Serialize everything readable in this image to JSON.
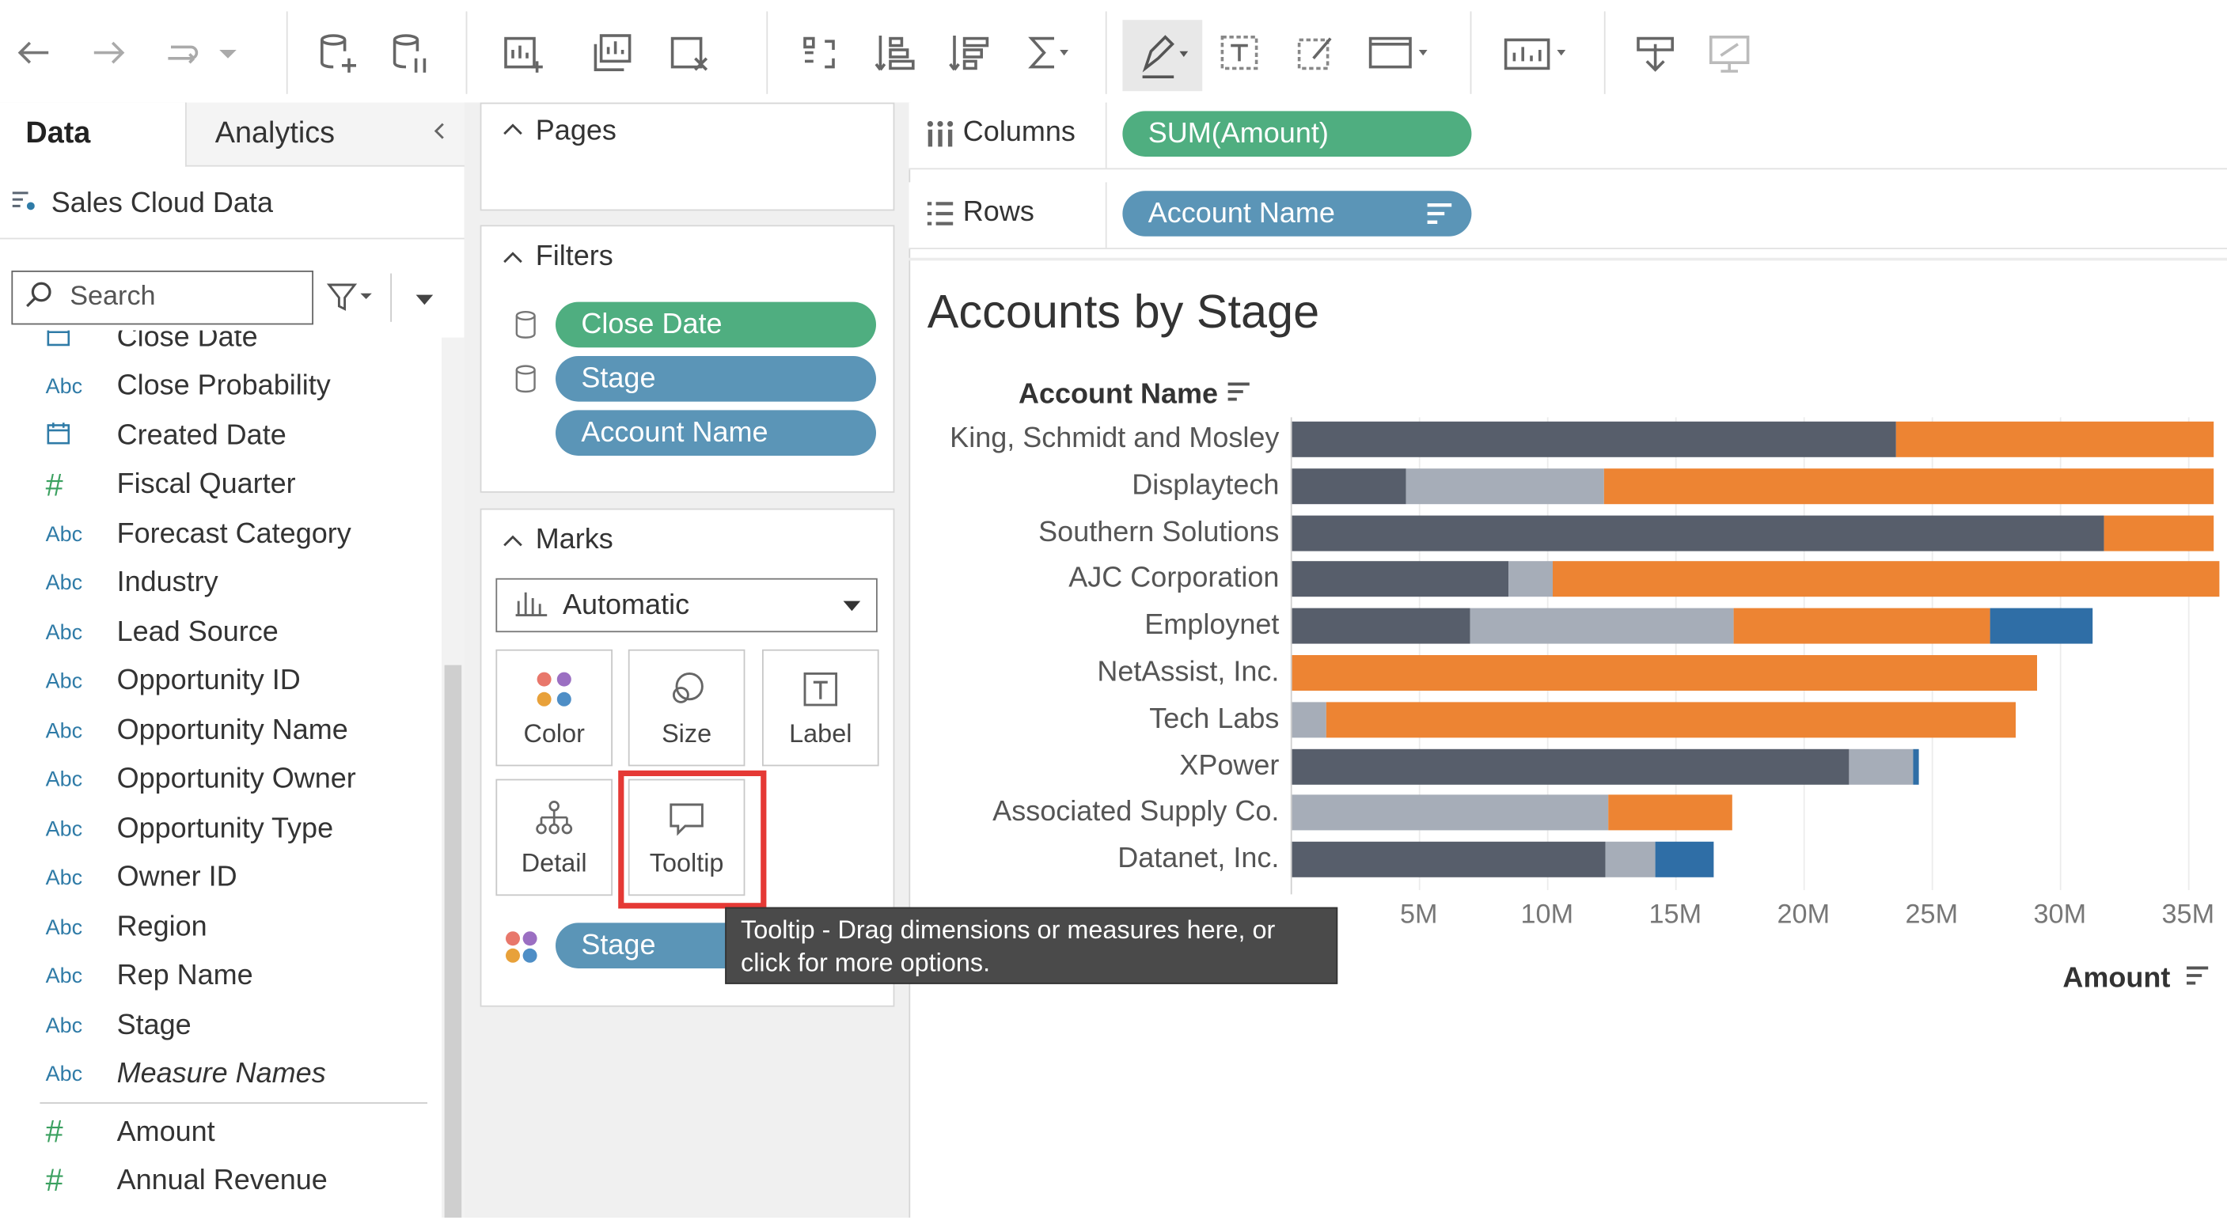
{
  "left_pane": {
    "tabs": [
      "Data",
      "Analytics"
    ],
    "datasource": "Sales Cloud Data",
    "search_placeholder": "Search",
    "fields": [
      {
        "icon": "date",
        "name": "Close Date"
      },
      {
        "icon": "abc",
        "name": "Close Probability"
      },
      {
        "icon": "date",
        "name": "Created Date"
      },
      {
        "icon": "hash",
        "name": "Fiscal Quarter"
      },
      {
        "icon": "abc",
        "name": "Forecast Category"
      },
      {
        "icon": "abc",
        "name": "Industry"
      },
      {
        "icon": "abc",
        "name": "Lead Source"
      },
      {
        "icon": "abc",
        "name": "Opportunity ID"
      },
      {
        "icon": "abc",
        "name": "Opportunity Name"
      },
      {
        "icon": "abc",
        "name": "Opportunity Owner"
      },
      {
        "icon": "abc",
        "name": "Opportunity Type"
      },
      {
        "icon": "abc",
        "name": "Owner ID"
      },
      {
        "icon": "abc",
        "name": "Region"
      },
      {
        "icon": "abc",
        "name": "Rep Name"
      },
      {
        "icon": "abc",
        "name": "Stage"
      },
      {
        "icon": "abc",
        "name": "Measure Names"
      }
    ],
    "measures": [
      {
        "icon": "hash",
        "name": "Amount"
      },
      {
        "icon": "hash",
        "name": "Annual Revenue"
      }
    ],
    "abc_text": "Abc",
    "hash_text": "#"
  },
  "cards": {
    "pages_title": "Pages",
    "filters_title": "Filters",
    "filters": [
      "Close Date",
      "Stage",
      "Account Name"
    ],
    "marks_title": "Marks",
    "mark_type": "Automatic",
    "mark_buttons": [
      "Color",
      "Size",
      "Label",
      "Detail",
      "Tooltip"
    ],
    "color_pill": "Stage"
  },
  "shelves": {
    "columns_label": "Columns",
    "columns_pill": "SUM(Amount)",
    "rows_label": "Rows",
    "rows_pill": "Account Name"
  },
  "tooltip": {
    "text": "Tooltip - Drag dimensions or measures here, or click for more options."
  },
  "colors": {
    "dark": "#575e6b",
    "light": "#a6adb8",
    "orange": "#ed8433",
    "blue": "#2f6ea6",
    "green_pill": "#4fae80",
    "blue_pill": "#5b95b7",
    "highlight": "#e53935"
  },
  "chart_data": {
    "type": "bar",
    "title": "Accounts by Stage",
    "row_header": "Account Name",
    "xlabel": "Amount",
    "xlim": [
      0,
      36
    ],
    "x_ticks": [
      "5M",
      "10M",
      "15M",
      "20M",
      "25M",
      "30M",
      "35M"
    ],
    "x_tick_values": [
      5,
      10,
      15,
      20,
      25,
      30,
      35
    ],
    "unit": "M",
    "categories": [
      "King, Schmidt and Mosley",
      "Displaytech",
      "Southern Solutions",
      "AJC Corporation",
      "Employnet",
      "NetAssist, Inc.",
      "Tech Labs",
      "XPower",
      "Associated Supply Co.",
      "Datanet, Inc."
    ],
    "series": [
      {
        "color": "#575e6b",
        "values": [
          23.6,
          4.5,
          31.7,
          8.5,
          7.0,
          0,
          0,
          21.8,
          0,
          12.3
        ]
      },
      {
        "color": "#a6adb8",
        "values": [
          0,
          7.7,
          0,
          1.7,
          10.3,
          0,
          1.4,
          2.5,
          12.4,
          1.9
        ]
      },
      {
        "color": "#ed8433",
        "values": [
          12.4,
          23.8,
          4.3,
          26.0,
          10.0,
          29.1,
          26.9,
          0,
          4.8,
          0
        ]
      },
      {
        "color": "#2f6ea6",
        "values": [
          0,
          0,
          0,
          0,
          4.0,
          0,
          0,
          0.2,
          0,
          2.3
        ]
      }
    ]
  }
}
